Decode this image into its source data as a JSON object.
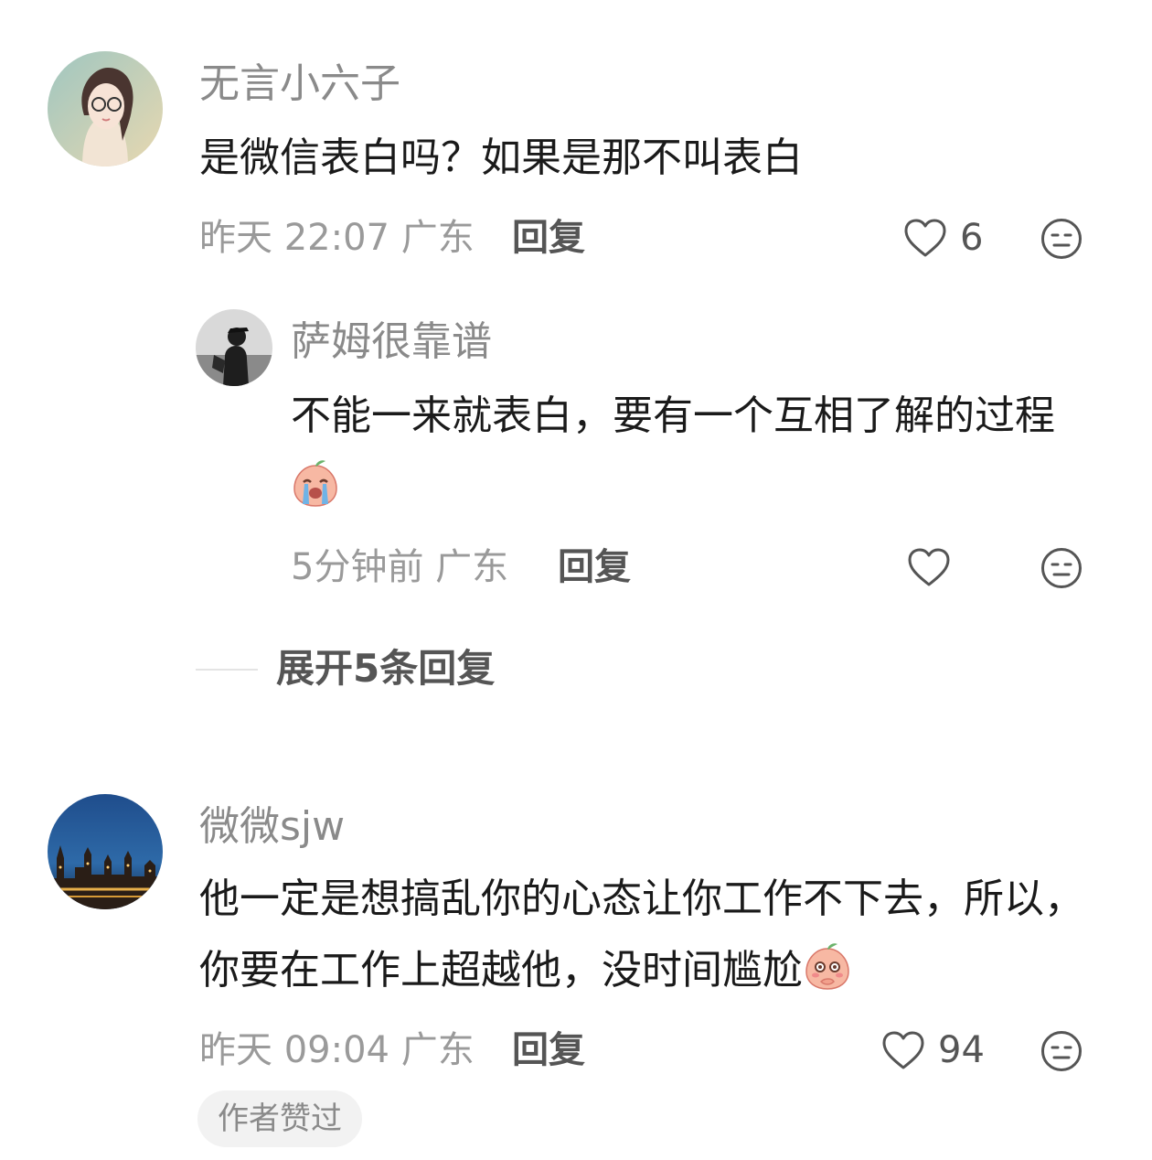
{
  "comments": [
    {
      "username": "无言小六子",
      "text": "是微信表白吗？如果是那不叫表白",
      "time": "昨天 22:07 广东",
      "reply_label": "回复",
      "likes": "6",
      "replies": [
        {
          "username": "萨姆很靠谱",
          "text": "不能一来就表白，要有一个互相了解的过程",
          "emoji": "crying-peach-emoji",
          "time": "5分钟前 广东",
          "reply_label": "回复"
        }
      ],
      "expand_label": "展开5条回复"
    },
    {
      "username": "微微sjw",
      "text": "他一定是想搞乱你的心态让你工作不下去，所以，你要在工作上超越他，没时间尴尬",
      "emoji": "embarrassed-peach-emoji",
      "time": "昨天 09:04 广东",
      "reply_label": "回复",
      "likes": "94",
      "badge": "作者赞过"
    }
  ],
  "icons": {
    "heart": "heart-outline-icon",
    "dislike": "neutral-face-icon"
  }
}
